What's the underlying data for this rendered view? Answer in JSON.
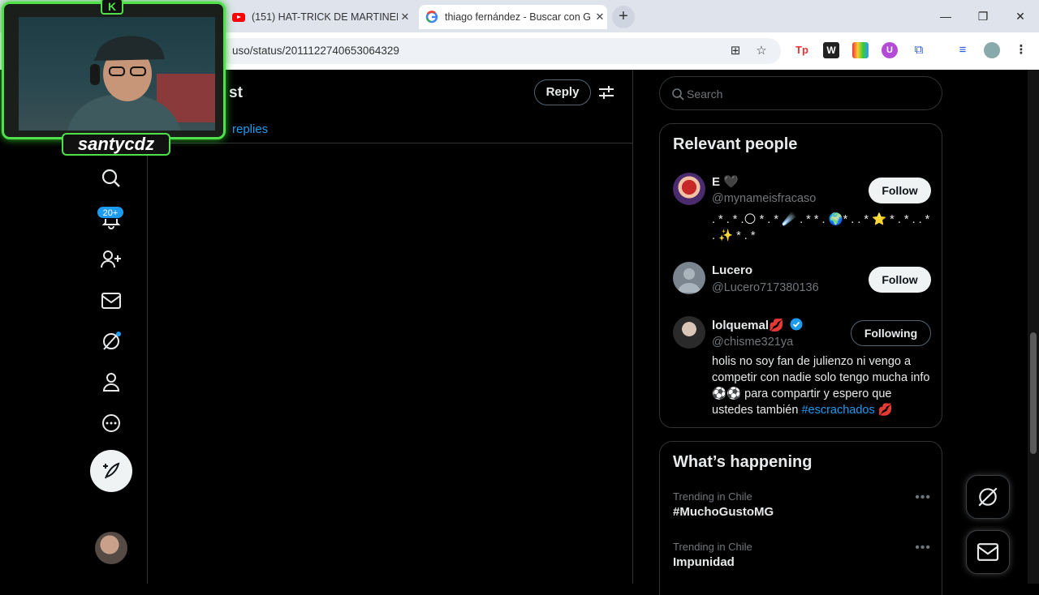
{
  "browser": {
    "tabs": [
      {
        "title": "(151) HAT-TRICK DE MARTINEL",
        "icon": "youtube-icon"
      },
      {
        "title": "thiago fernández - Buscar con G",
        "icon": "google-icon"
      }
    ],
    "url": "uso/status/2011122740653064329"
  },
  "webcam": {
    "label": "santycdz",
    "logo": "K"
  },
  "sidebar": {
    "notifications_badge": "20+"
  },
  "main": {
    "title": "st",
    "reply_label": "Reply",
    "replies_link": "replies"
  },
  "search": {
    "placeholder": "Search"
  },
  "relevant_people": {
    "title": "Relevant people",
    "people": [
      {
        "name": "E 🖤",
        "handle": "@mynameisfracaso",
        "bio": ". * . * .🌕 * . * ☄️ . * * . 🌍* . . * ⭐ * . * . . * . ✨ * . *",
        "action": "Follow"
      },
      {
        "name": "Lucero",
        "handle": "@Lucero717380136",
        "bio": "",
        "action": "Follow"
      },
      {
        "name": "lolquemal💋",
        "handle": "@chisme321ya",
        "bio_text": "holis no soy fan de julienzo ni vengo a competir con nadie solo tengo mucha info ⚽⚽ para compartir y espero que ustedes también ",
        "bio_hashtag": "#escrachados",
        "bio_end": " 💋",
        "action": "Following"
      }
    ]
  },
  "whats_happening": {
    "title": "What’s happening",
    "trends": [
      {
        "context": "Trending in Chile",
        "name": "#MuchoGustoMG"
      },
      {
        "context": "Trending in Chile",
        "name": "Impunidad"
      }
    ]
  },
  "colors": {
    "accent": "#1d9bf0",
    "background": "#000000",
    "border": "#2f3336",
    "webcam_border": "#4fe04a",
    "verified": "#1d9bf0"
  }
}
